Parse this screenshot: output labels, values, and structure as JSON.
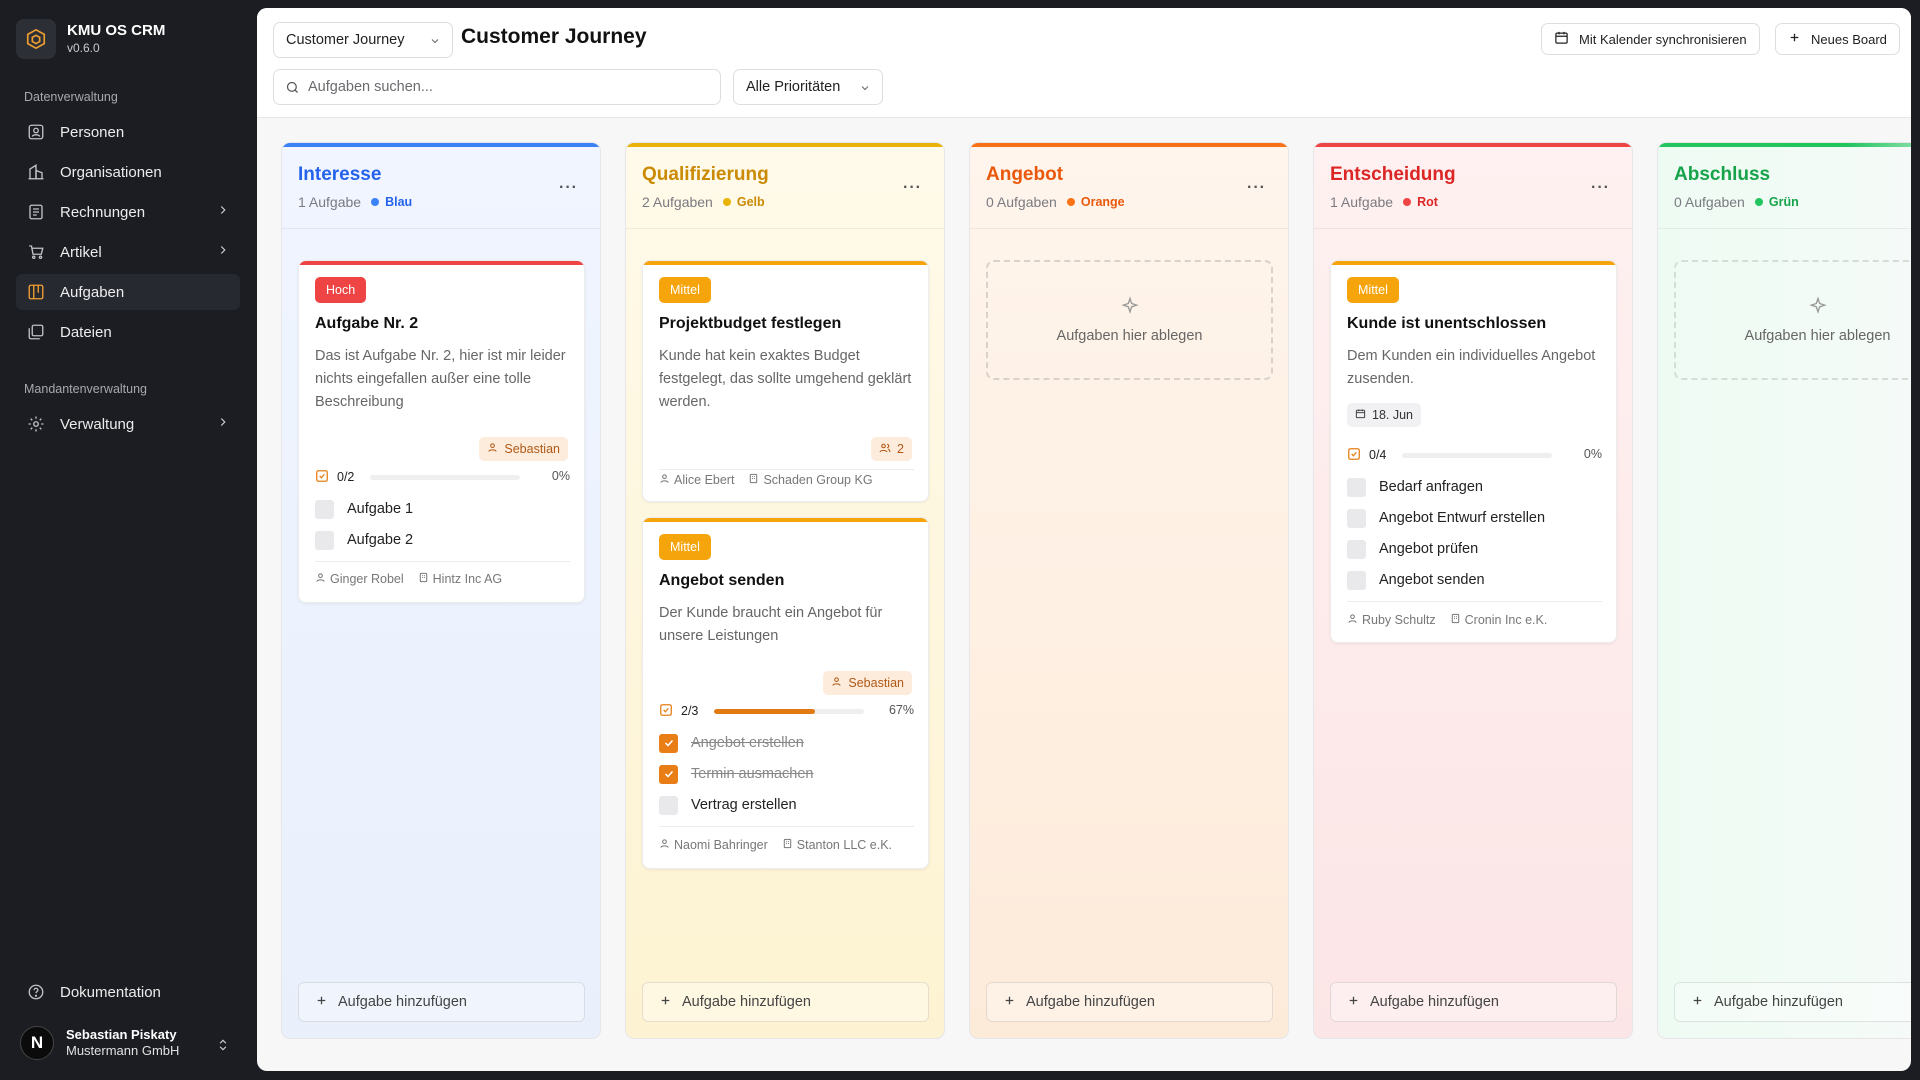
{
  "app": {
    "name": "KMU OS CRM",
    "version": "v0.6.0"
  },
  "sidebar": {
    "section_data": "Datenverwaltung",
    "items": [
      {
        "label": "Personen",
        "icon": "persons-icon"
      },
      {
        "label": "Organisationen",
        "icon": "building-icon"
      },
      {
        "label": "Rechnungen",
        "icon": "invoice-icon"
      },
      {
        "label": "Artikel",
        "icon": "cart-icon"
      },
      {
        "label": "Aufgaben",
        "icon": "kanban-icon"
      },
      {
        "label": "Dateien",
        "icon": "files-icon"
      }
    ],
    "section_tenant": "Mandantenverwaltung",
    "admin": {
      "label": "Verwaltung",
      "icon": "gear-icon"
    },
    "docs": {
      "label": "Dokumentation",
      "icon": "help-icon"
    },
    "user": {
      "initial": "N",
      "name": "Sebastian Piskaty",
      "org": "Mustermann GmbH"
    }
  },
  "header": {
    "board_select": "Customer Journey",
    "title": "Customer Journey",
    "search_placeholder": "Aufgaben suchen...",
    "priority_select": "Alle Prioritäten",
    "sync_label": "Mit Kalender synchronisieren",
    "new_board_label": "Neues Board"
  },
  "board": {
    "drop_label": "Aufgaben hier ablegen",
    "add_label": "Aufgabe hinzufügen",
    "columns": [
      {
        "title": "Interesse",
        "count": "1 Aufgabe",
        "color_label": "Blau",
        "color": "#3b82f6"
      },
      {
        "title": "Qualifizierung",
        "count": "2 Aufgaben",
        "color_label": "Gelb",
        "color": "#eab308"
      },
      {
        "title": "Angebot",
        "count": "0 Aufgaben",
        "color_label": "Orange",
        "color": "#f97316"
      },
      {
        "title": "Entscheidung",
        "count": "1 Aufgabe",
        "color_label": "Rot",
        "color": "#ef4444"
      },
      {
        "title": "Abschluss",
        "count": "0 Aufgaben",
        "color_label": "Grün",
        "color": "#22c55e"
      }
    ]
  },
  "cards": {
    "c1": {
      "priority": "Hoch",
      "title": "Aufgabe Nr. 2",
      "desc": "Das ist Aufgabe Nr. 2, hier ist mir leider nichts eingefallen außer eine tolle Beschreibung",
      "assignee": "Sebastian",
      "progress_count": "0/2",
      "progress_pct": "0%",
      "progress": 0,
      "subtasks": [
        {
          "label": "Aufgabe 1",
          "done": false
        },
        {
          "label": "Aufgabe 2",
          "done": false
        }
      ],
      "person": "Ginger Robel",
      "company": "Hintz Inc AG"
    },
    "c2": {
      "priority": "Mittel",
      "title": "Projektbudget festlegen",
      "desc": "Kunde hat kein exaktes Budget festgelegt, das sollte umgehend geklärt werden.",
      "assignees_count": "2",
      "person": "Alice Ebert",
      "company": "Schaden Group KG"
    },
    "c3": {
      "priority": "Mittel",
      "title": "Angebot senden",
      "desc": "Der Kunde braucht ein Angebot für unsere Leistungen",
      "assignee": "Sebastian",
      "progress_count": "2/3",
      "progress_pct": "67%",
      "progress": 0.67,
      "subtasks": [
        {
          "label": "Angebot erstellen",
          "done": true
        },
        {
          "label": "Termin ausmachen",
          "done": true
        },
        {
          "label": "Vertrag erstellen",
          "done": false
        }
      ],
      "person": "Naomi Bahringer",
      "company": "Stanton LLC e.K."
    },
    "c4": {
      "priority": "Mittel",
      "title": "Kunde ist unentschlossen",
      "desc": "Dem Kunden ein individuelles Angebot zusenden.",
      "date": "18. Jun",
      "progress_count": "0/4",
      "progress_pct": "0%",
      "progress": 0,
      "subtasks": [
        {
          "label": "Bedarf anfragen",
          "done": false
        },
        {
          "label": "Angebot Entwurf erstellen",
          "done": false
        },
        {
          "label": "Angebot prüfen",
          "done": false
        },
        {
          "label": "Angebot senden",
          "done": false
        }
      ],
      "person": "Ruby Schultz",
      "company": "Cronin Inc e.K."
    }
  },
  "colors": {
    "high": "#ef4444",
    "medium": "#f5a40b",
    "accent": "#e87e15"
  }
}
